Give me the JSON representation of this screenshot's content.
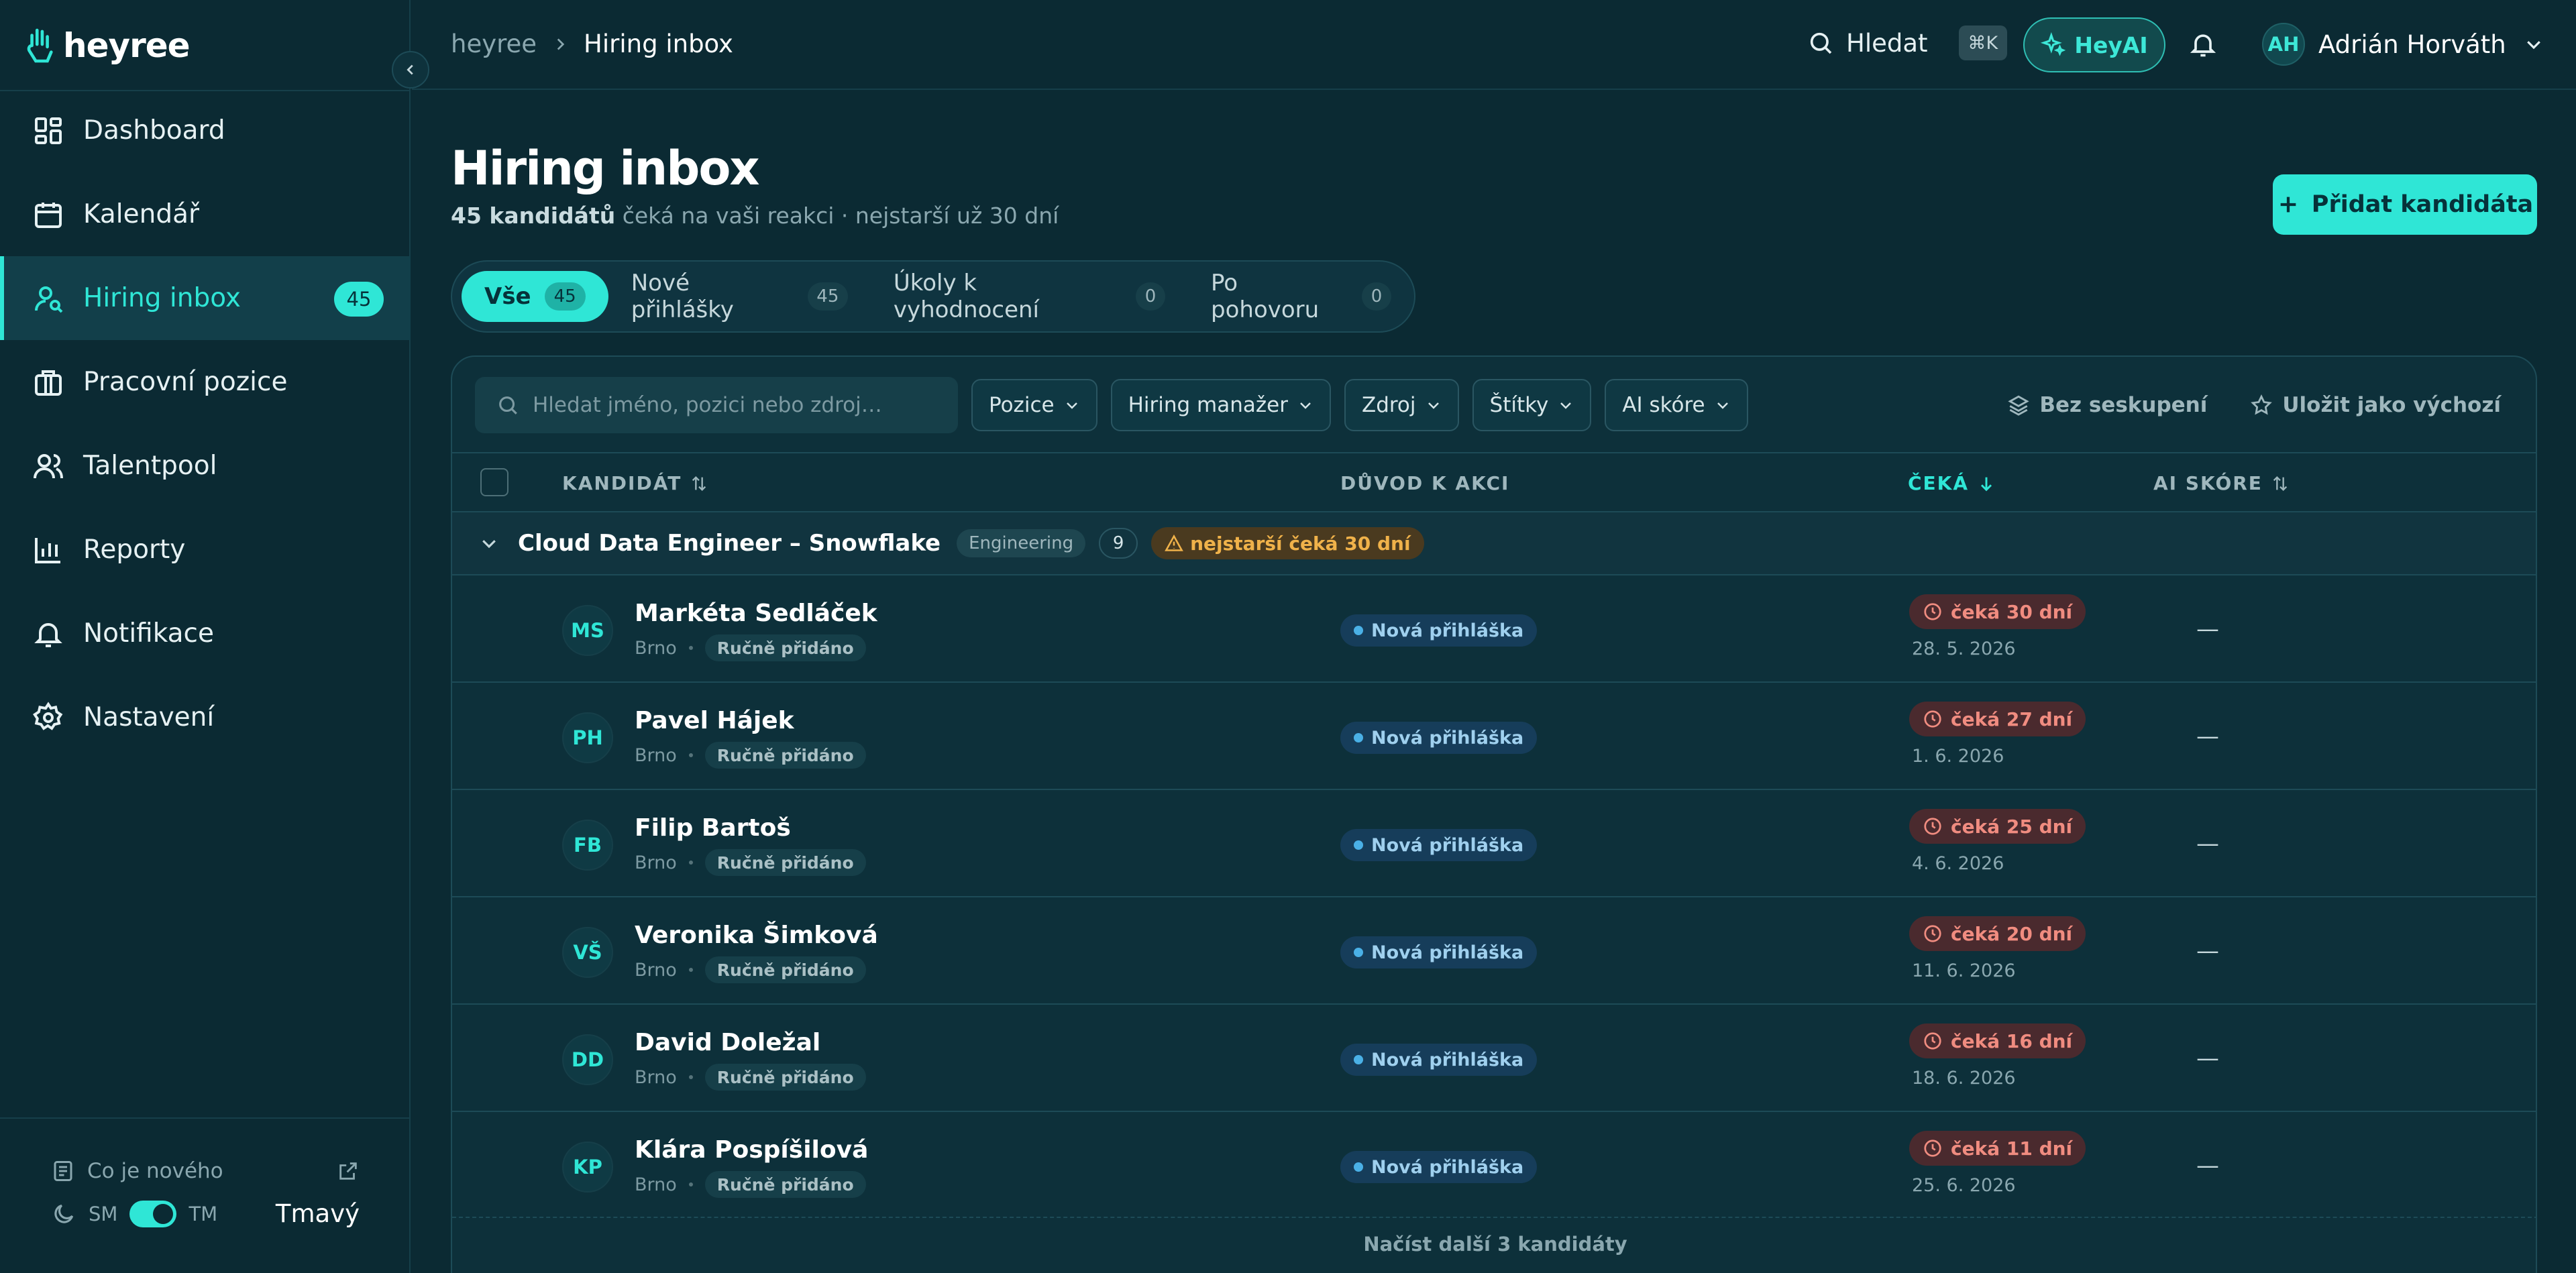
{
  "brand": {
    "name": "heyree"
  },
  "sidebar": {
    "items": [
      {
        "label": "Dashboard",
        "icon": "dashboard-icon"
      },
      {
        "label": "Kalendář",
        "icon": "calendar-icon"
      },
      {
        "label": "Hiring inbox",
        "icon": "user-search-icon",
        "badge": "45",
        "active": true
      },
      {
        "label": "Pracovní pozice",
        "icon": "briefcase-icon"
      },
      {
        "label": "Talentpool",
        "icon": "users-icon"
      },
      {
        "label": "Reporty",
        "icon": "bar-chart-icon"
      },
      {
        "label": "Notifikace",
        "icon": "bell-icon"
      },
      {
        "label": "Nastavení",
        "icon": "gear-icon"
      }
    ],
    "whats_new": "Co je nového",
    "theme": {
      "sm": "SM",
      "tm": "TM",
      "current": "Tmavý"
    }
  },
  "topbar": {
    "breadcrumb": [
      "heyree",
      "Hiring inbox"
    ],
    "search_label": "Hledat",
    "shortcut": "⌘K",
    "heyai_label": "HeyAI",
    "user": {
      "initials": "AH",
      "name": "Adrián Horváth"
    }
  },
  "page": {
    "title": "Hiring inbox",
    "subtitle_bold": "45 kandidátů",
    "subtitle_rest": " čeká na vaši reakci · nejstarší už 30 dní",
    "add_button": "Přidat kandidáta"
  },
  "tabs": [
    {
      "label": "Vše",
      "count": "45",
      "active": true
    },
    {
      "label": "Nové přihlášky",
      "count": "45"
    },
    {
      "label": "Úkoly k vyhodnocení",
      "count": "0"
    },
    {
      "label": "Po pohovoru",
      "count": "0"
    }
  ],
  "filters": {
    "search_placeholder": "Hledat jméno, pozici nebo zdroj…",
    "buttons": [
      "Pozice",
      "Hiring manažer",
      "Zdroj",
      "Štítky",
      "AI skóre"
    ],
    "group_label": "Bez seskupení",
    "save_label": "Uložit jako výchozí"
  },
  "table": {
    "columns": [
      "KANDIDÁT",
      "DŮVOD K AKCI",
      "ČEKÁ",
      "AI SKÓRE"
    ],
    "group": {
      "title": "Cloud Data Engineer – Snowflake",
      "tag": "Engineering",
      "count": "9",
      "warning": "nejstarší čeká 30 dní"
    },
    "rows": [
      {
        "initials": "MS",
        "name": "Markéta Sedláček",
        "city": "Brno",
        "source": "Ručně přidáno",
        "status": "Nová přihláška",
        "wait": "čeká 30 dní",
        "date": "28. 5. 2026",
        "ai": "—"
      },
      {
        "initials": "PH",
        "name": "Pavel Hájek",
        "city": "Brno",
        "source": "Ručně přidáno",
        "status": "Nová přihláška",
        "wait": "čeká 27 dní",
        "date": "1. 6. 2026",
        "ai": "—"
      },
      {
        "initials": "FB",
        "name": "Filip Bartoš",
        "city": "Brno",
        "source": "Ručně přidáno",
        "status": "Nová přihláška",
        "wait": "čeká 25 dní",
        "date": "4. 6. 2026",
        "ai": "—"
      },
      {
        "initials": "VŠ",
        "name": "Veronika Šimková",
        "city": "Brno",
        "source": "Ručně přidáno",
        "status": "Nová přihláška",
        "wait": "čeká 20 dní",
        "date": "11. 6. 2026",
        "ai": "—"
      },
      {
        "initials": "DD",
        "name": "David Doležal",
        "city": "Brno",
        "source": "Ručně přidáno",
        "status": "Nová přihláška",
        "wait": "čeká 16 dní",
        "date": "18. 6. 2026",
        "ai": "—"
      },
      {
        "initials": "KP",
        "name": "Klára Pospíšilová",
        "city": "Brno",
        "source": "Ručně přidáno",
        "status": "Nová přihláška",
        "wait": "čeká 11 dní",
        "date": "25. 6. 2026",
        "ai": "—"
      }
    ],
    "load_more": "Načíst další 3 kandidáty"
  },
  "colors": {
    "accent": "#2fe6d6",
    "background": "#0b2a33",
    "warning": "#f0b24a",
    "danger": "#f08c80",
    "info": "#4ab0e6"
  }
}
